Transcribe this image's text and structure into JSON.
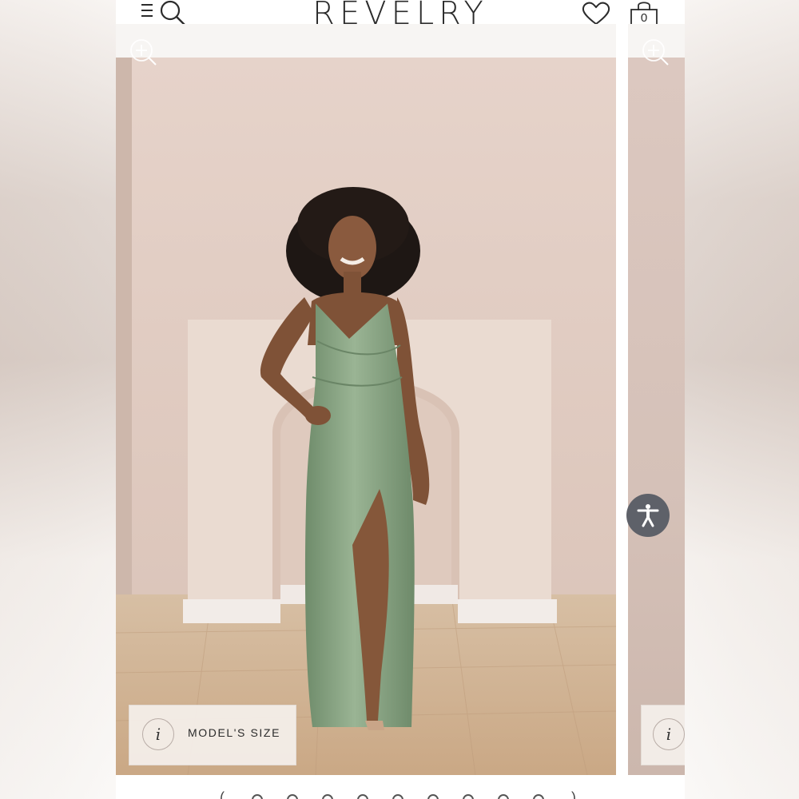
{
  "header": {
    "brand": "REVELRY",
    "menu_icon": "menu-search-icon",
    "wishlist_icon": "heart-icon",
    "bag_icon": "shopping-bag-icon",
    "bag_count": "0"
  },
  "gallery": {
    "zoom_icon": "zoom-in-icon",
    "main_image_alt": "Model wearing a sage green satin wrap maxi dress with front slit",
    "size_badge": {
      "icon": "info-icon",
      "info_glyph": "i",
      "label": "MODEL'S SIZE"
    },
    "next_badge": {
      "info_glyph": "i"
    }
  },
  "accessibility": {
    "icon": "accessibility-icon"
  },
  "carousel": {
    "dot_count": 9,
    "prev_glyph": "(",
    "next_glyph": ")"
  },
  "colors": {
    "dress": "#8aa583",
    "wall": "#e3cfc6",
    "floor": "#d6b898",
    "accent_dark": "#2b2b2b",
    "accessibility_bg": "#5e6169"
  }
}
